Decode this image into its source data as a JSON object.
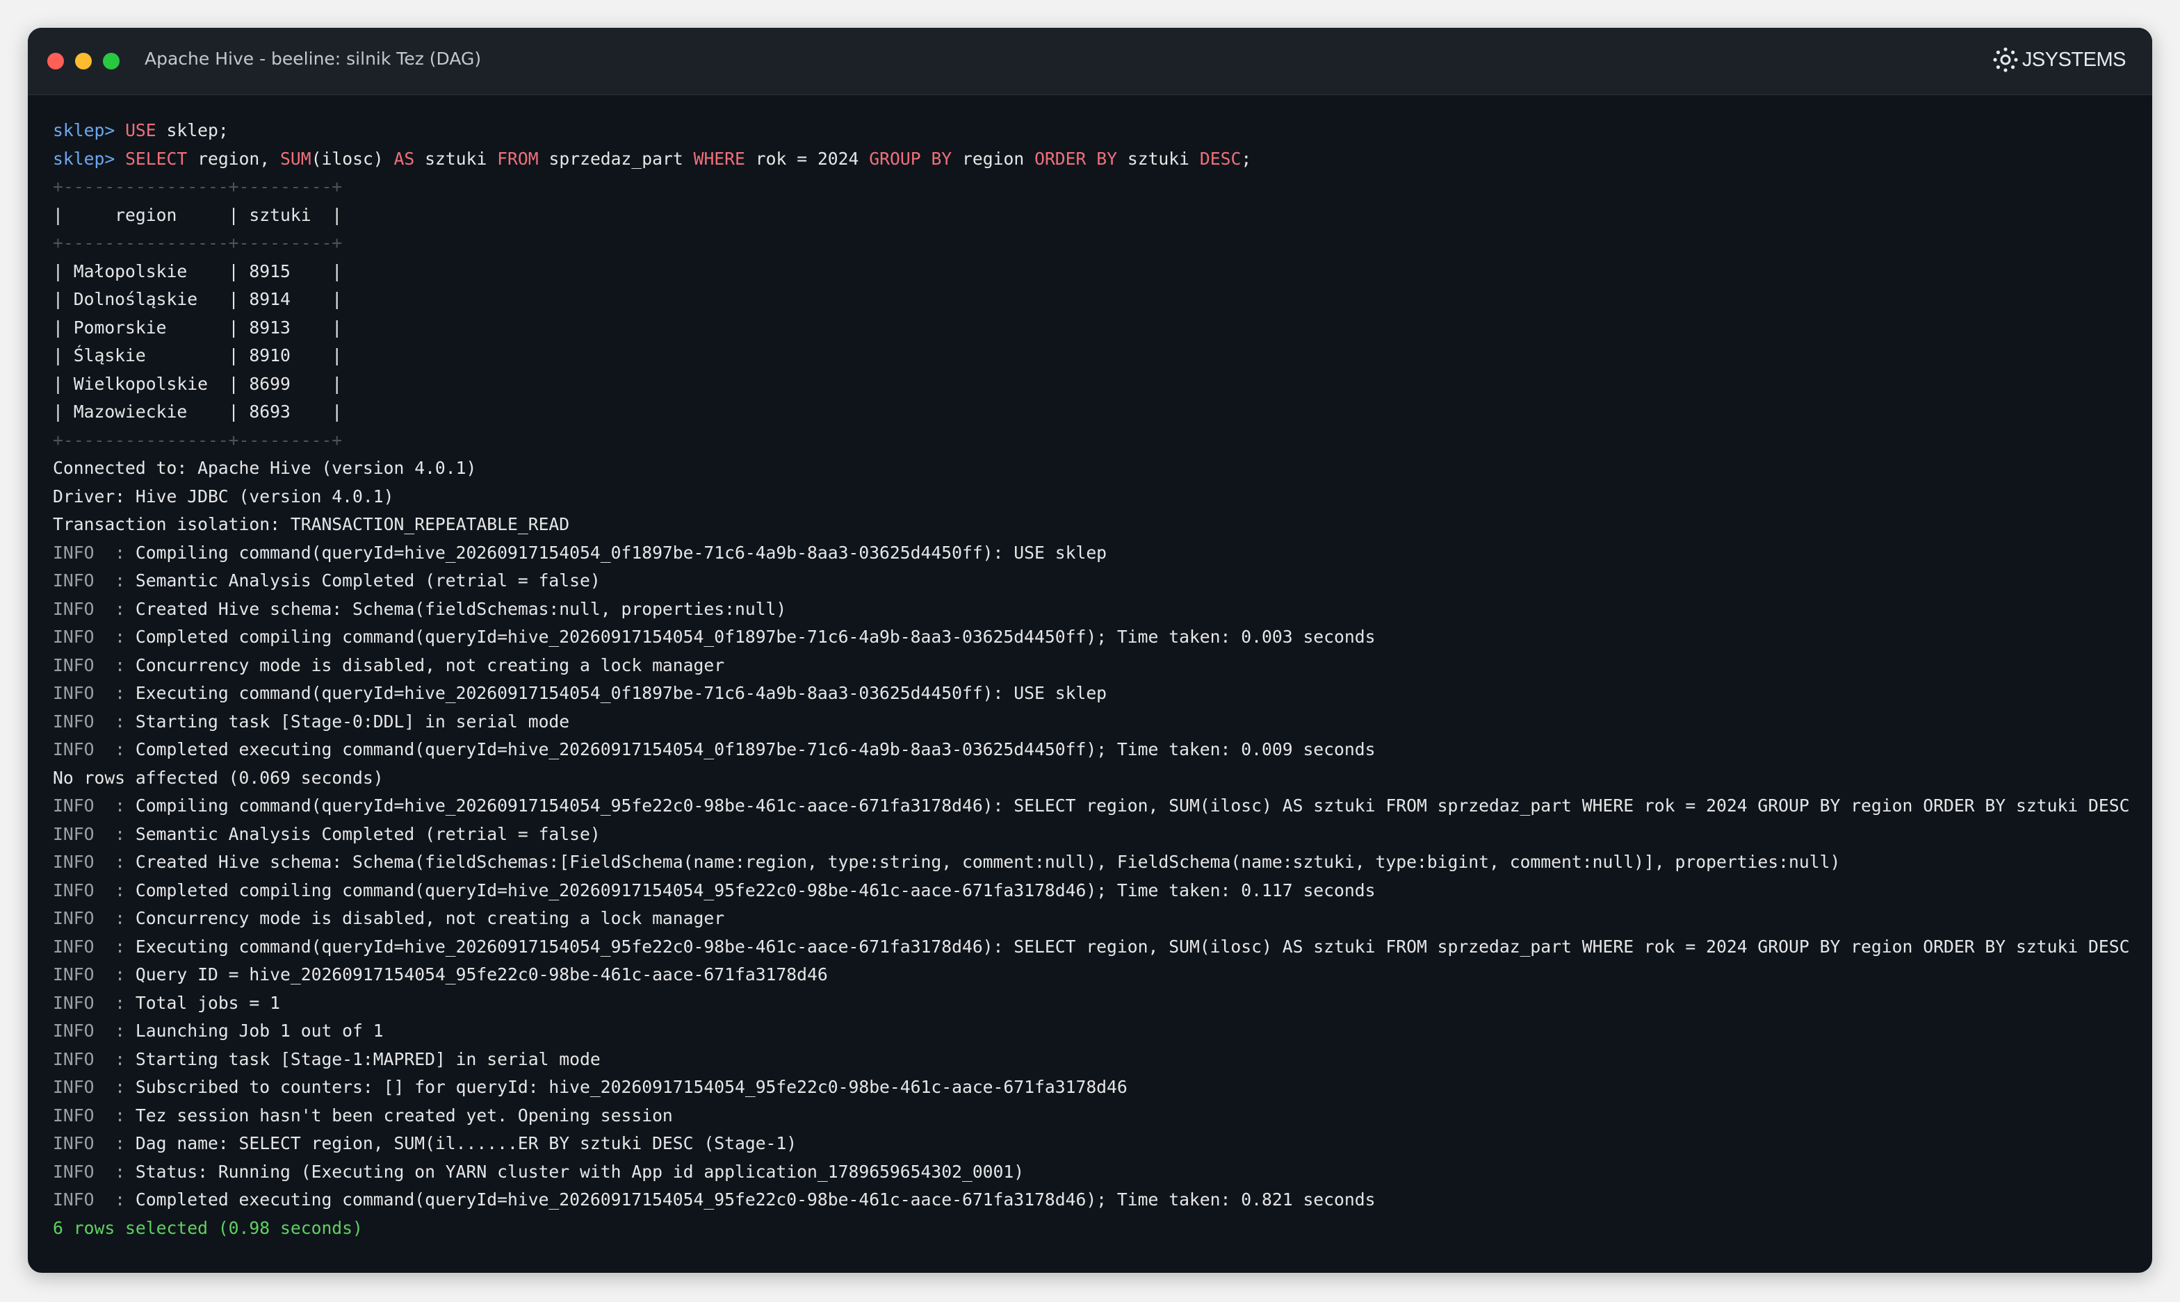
{
  "window": {
    "title": "Apache Hive - beeline: silnik Tez (DAG)",
    "brand": "JSYSTEMS",
    "colors": {
      "background": "#0f141b",
      "titlebar": "#1c2128",
      "prompt": "#6ca8f0",
      "keyword": "#f0707a",
      "success": "#5fd25f"
    },
    "traffic_lights": [
      "close",
      "minimize",
      "maximize"
    ]
  },
  "terminal": {
    "prompt": "sklep>",
    "commands": [
      [
        {
          "t": "USE",
          "kw": true
        },
        {
          "t": " sklep;"
        }
      ],
      [
        {
          "t": "SELECT",
          "kw": true
        },
        {
          "t": " region, "
        },
        {
          "t": "SUM",
          "kw": true
        },
        {
          "t": "(ilosc) "
        },
        {
          "t": "AS",
          "kw": true
        },
        {
          "t": " sztuki "
        },
        {
          "t": "FROM",
          "kw": true
        },
        {
          "t": " sprzedaz_part "
        },
        {
          "t": "WHERE",
          "kw": true
        },
        {
          "t": " rok = 2024 "
        },
        {
          "t": "GROUP BY",
          "kw": true
        },
        {
          "t": " region "
        },
        {
          "t": "ORDER BY",
          "kw": true
        },
        {
          "t": " sztuki "
        },
        {
          "t": "DESC",
          "kw": true
        },
        {
          "t": ";"
        }
      ]
    ],
    "table": {
      "border": "+----------------+---------+",
      "header": "|     region     | sztuki  |",
      "rows": [
        "| Małopolskie    | 8915    |",
        "| Dolnośląskie   | 8914    |",
        "| Pomorskie      | 8913    |",
        "| Śląskie        | 8910    |",
        "| Wielkopolskie  | 8699    |",
        "| Mazowieckie    | 8693    |"
      ]
    },
    "info_lines": [
      {
        "p": "",
        "t": "Connected to: Apache Hive (version 4.0.1)"
      },
      {
        "p": "",
        "t": "Driver: Hive JDBC (version 4.0.1)"
      },
      {
        "p": "",
        "t": "Transaction isolation: TRANSACTION_REPEATABLE_READ"
      },
      {
        "p": "INFO  :",
        "t": " Compiling command(queryId=hive_20260917154054_0f1897be-71c6-4a9b-8aa3-03625d4450ff): USE sklep"
      },
      {
        "p": "INFO  :",
        "t": " Semantic Analysis Completed (retrial = false)"
      },
      {
        "p": "INFO  :",
        "t": " Created Hive schema: Schema(fieldSchemas:null, properties:null)"
      },
      {
        "p": "INFO  :",
        "t": " Completed compiling command(queryId=hive_20260917154054_0f1897be-71c6-4a9b-8aa3-03625d4450ff); Time taken: 0.003 seconds"
      },
      {
        "p": "INFO  :",
        "t": " Concurrency mode is disabled, not creating a lock manager"
      },
      {
        "p": "INFO  :",
        "t": " Executing command(queryId=hive_20260917154054_0f1897be-71c6-4a9b-8aa3-03625d4450ff): USE sklep"
      },
      {
        "p": "INFO  :",
        "t": " Starting task [Stage-0:DDL] in serial mode"
      },
      {
        "p": "INFO  :",
        "t": " Completed executing command(queryId=hive_20260917154054_0f1897be-71c6-4a9b-8aa3-03625d4450ff); Time taken: 0.009 seconds"
      },
      {
        "p": "",
        "t": "No rows affected (0.069 seconds)"
      },
      {
        "p": "INFO  :",
        "t": " Compiling command(queryId=hive_20260917154054_95fe22c0-98be-461c-aace-671fa3178d46): SELECT region, SUM(ilosc) AS sztuki FROM sprzedaz_part WHERE rok = 2024 GROUP BY region ORDER BY sztuki DESC"
      },
      {
        "p": "INFO  :",
        "t": " Semantic Analysis Completed (retrial = false)"
      },
      {
        "p": "INFO  :",
        "t": " Created Hive schema: Schema(fieldSchemas:[FieldSchema(name:region, type:string, comment:null), FieldSchema(name:sztuki, type:bigint, comment:null)], properties:null)"
      },
      {
        "p": "INFO  :",
        "t": " Completed compiling command(queryId=hive_20260917154054_95fe22c0-98be-461c-aace-671fa3178d46); Time taken: 0.117 seconds"
      },
      {
        "p": "INFO  :",
        "t": " Concurrency mode is disabled, not creating a lock manager"
      },
      {
        "p": "INFO  :",
        "t": " Executing command(queryId=hive_20260917154054_95fe22c0-98be-461c-aace-671fa3178d46): SELECT region, SUM(ilosc) AS sztuki FROM sprzedaz_part WHERE rok = 2024 GROUP BY region ORDER BY sztuki DESC"
      },
      {
        "p": "INFO  :",
        "t": " Query ID = hive_20260917154054_95fe22c0-98be-461c-aace-671fa3178d46"
      },
      {
        "p": "INFO  :",
        "t": " Total jobs = 1"
      },
      {
        "p": "INFO  :",
        "t": " Launching Job 1 out of 1"
      },
      {
        "p": "INFO  :",
        "t": " Starting task [Stage-1:MAPRED] in serial mode"
      },
      {
        "p": "INFO  :",
        "t": " Subscribed to counters: [] for queryId: hive_20260917154054_95fe22c0-98be-461c-aace-671fa3178d46"
      },
      {
        "p": "INFO  :",
        "t": " Tez session hasn't been created yet. Opening session"
      },
      {
        "p": "INFO  :",
        "t": " Dag name: SELECT region, SUM(il......ER BY sztuki DESC (Stage-1)"
      },
      {
        "p": "INFO  :",
        "t": " Status: Running (Executing on YARN cluster with App id application_1789659654302_0001)"
      },
      {
        "p": "INFO  :",
        "t": " Completed executing command(queryId=hive_20260917154054_95fe22c0-98be-461c-aace-671fa3178d46); Time taken: 0.821 seconds"
      }
    ],
    "result_line": "6 rows selected (0.98 seconds)"
  }
}
